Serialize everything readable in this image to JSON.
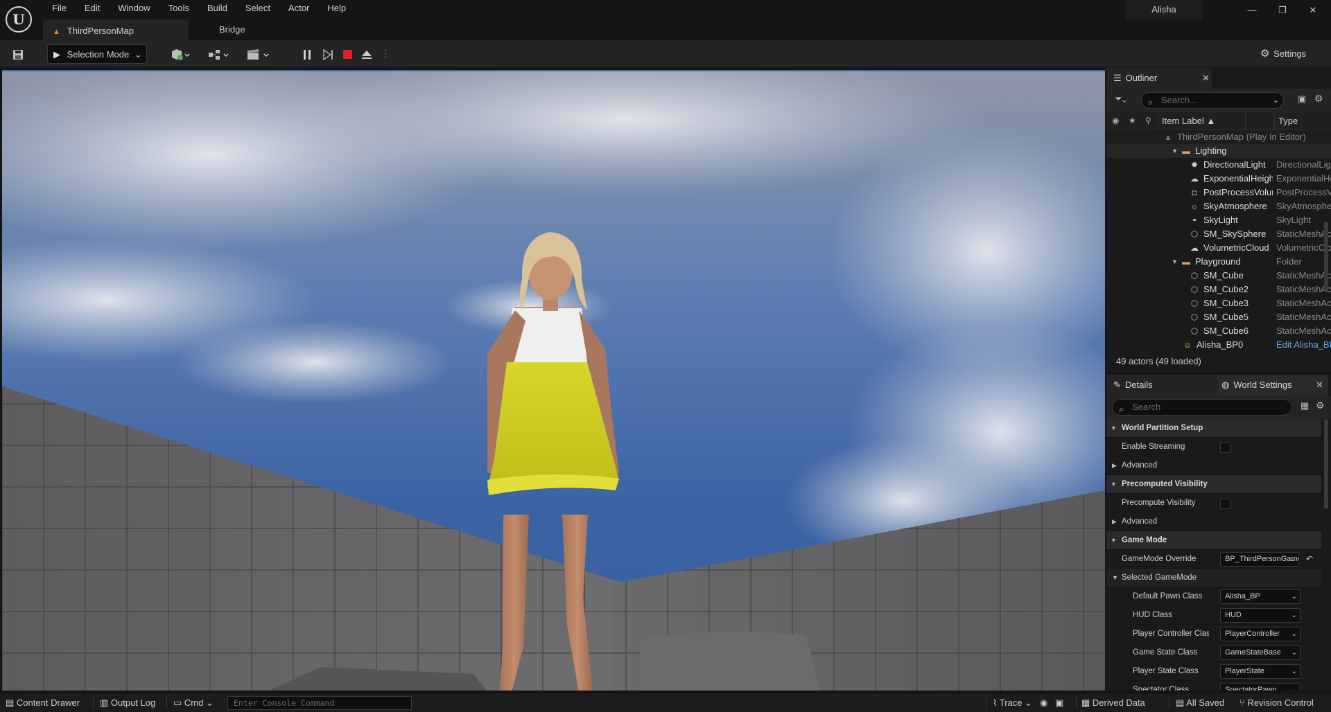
{
  "window": {
    "user": "Alisha",
    "minimize": "—",
    "restore": "❐",
    "close": "✕"
  },
  "menu": [
    "File",
    "Edit",
    "Window",
    "Tools",
    "Build",
    "Select",
    "Actor",
    "Help"
  ],
  "tabs": {
    "active": "ThirdPersonMap",
    "other": "Bridge"
  },
  "toolbar": {
    "selection_mode": "Selection Mode",
    "settings": "Settings"
  },
  "outliner": {
    "title": "Outliner",
    "search_placeholder": "Search...",
    "col_label": "Item Label ▲",
    "col_type": "Type",
    "root": "ThirdPersonMap (Play In Editor)",
    "rows": [
      {
        "name": "Lighting",
        "type": "",
        "icon": "folder-icon"
      },
      {
        "name": "DirectionalLight",
        "type": "DirectionalLight",
        "icon": "directional-light-icon"
      },
      {
        "name": "ExponentialHeightFog",
        "type": "ExponentialHeightFog",
        "icon": "fog-icon"
      },
      {
        "name": "PostProcessVolume",
        "type": "PostProcessVolume",
        "icon": "post-process-icon"
      },
      {
        "name": "SkyAtmosphere",
        "type": "SkyAtmosphere",
        "icon": "sky-atmosphere-icon"
      },
      {
        "name": "SkyLight",
        "type": "SkyLight",
        "icon": "sky-light-icon"
      },
      {
        "name": "SM_SkySphere",
        "type": "StaticMeshActor",
        "icon": "static-mesh-icon"
      },
      {
        "name": "VolumetricCloud",
        "type": "VolumetricCloud",
        "icon": "cloud-icon"
      },
      {
        "name": "Playground",
        "type": "Folder",
        "icon": "folder-icon"
      },
      {
        "name": "SM_Cube",
        "type": "StaticMeshActor",
        "icon": "static-mesh-icon"
      },
      {
        "name": "SM_Cube2",
        "type": "StaticMeshActor",
        "icon": "static-mesh-icon"
      },
      {
        "name": "SM_Cube3",
        "type": "StaticMeshActor",
        "icon": "static-mesh-icon"
      },
      {
        "name": "SM_Cube5",
        "type": "StaticMeshActor",
        "icon": "static-mesh-icon"
      },
      {
        "name": "SM_Cube6",
        "type": "StaticMeshActor",
        "icon": "static-mesh-icon"
      },
      {
        "name": "Alisha_BP0",
        "type": "Edit Alisha_BP",
        "icon": "pawn-icon"
      }
    ],
    "actor_count": "49 actors (49 loaded)"
  },
  "details": {
    "tab_details": "Details",
    "tab_world": "World Settings",
    "search_placeholder": "Search",
    "rows": [
      {
        "kind": "cat",
        "label": "World Partition Setup"
      },
      {
        "kind": "check",
        "label": "Enable Streaming"
      },
      {
        "kind": "collapsed",
        "label": "Advanced"
      },
      {
        "kind": "cat",
        "label": "Precomputed Visibility"
      },
      {
        "kind": "check",
        "label": "Precompute Visibility"
      },
      {
        "kind": "collapsed",
        "label": "Advanced"
      },
      {
        "kind": "cat",
        "label": "Game Mode"
      },
      {
        "kind": "combo",
        "label": "GameMode Override",
        "value": "BP_ThirdPersonGameMode"
      },
      {
        "kind": "sub",
        "label": "Selected GameMode"
      },
      {
        "kind": "combo2",
        "label": "Default Pawn Class",
        "value": "Alisha_BP"
      },
      {
        "kind": "combo2",
        "label": "HUD Class",
        "value": "HUD"
      },
      {
        "kind": "combo2",
        "label": "Player Controller Class",
        "value": "PlayerController"
      },
      {
        "kind": "combo2",
        "label": "Game State Class",
        "value": "GameStateBase"
      },
      {
        "kind": "combo2",
        "label": "Player State Class",
        "value": "PlayerState"
      },
      {
        "kind": "combo2",
        "label": "Spectator Class",
        "value": "SpectatorPawn"
      }
    ]
  },
  "statusbar": {
    "content_drawer": "Content Drawer",
    "output_log": "Output Log",
    "cmd": "Cmd",
    "console_placeholder": "Enter Console Command",
    "trace": "Trace",
    "derived_data": "Derived Data",
    "all_saved": "All Saved",
    "revision_control": "Revision Control"
  },
  "colors": {
    "accent_blue": "#2a6fb0",
    "stop_red": "#e02020",
    "folder": "#c8a465"
  }
}
